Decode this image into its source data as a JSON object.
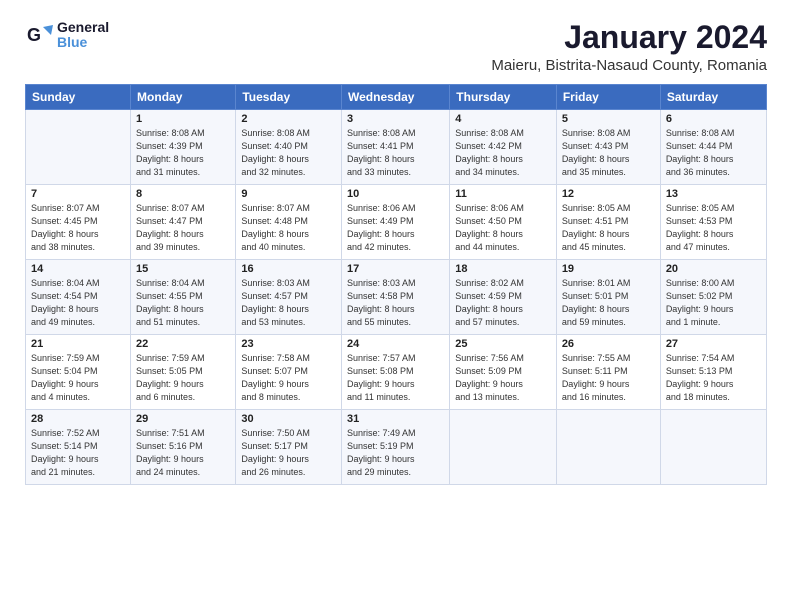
{
  "logo": {
    "line1": "General",
    "line2": "Blue"
  },
  "title": "January 2024",
  "subtitle": "Maieru, Bistrita-Nasaud County, Romania",
  "weekdays": [
    "Sunday",
    "Monday",
    "Tuesday",
    "Wednesday",
    "Thursday",
    "Friday",
    "Saturday"
  ],
  "weeks": [
    [
      {
        "day": "",
        "info": ""
      },
      {
        "day": "1",
        "info": "Sunrise: 8:08 AM\nSunset: 4:39 PM\nDaylight: 8 hours\nand 31 minutes."
      },
      {
        "day": "2",
        "info": "Sunrise: 8:08 AM\nSunset: 4:40 PM\nDaylight: 8 hours\nand 32 minutes."
      },
      {
        "day": "3",
        "info": "Sunrise: 8:08 AM\nSunset: 4:41 PM\nDaylight: 8 hours\nand 33 minutes."
      },
      {
        "day": "4",
        "info": "Sunrise: 8:08 AM\nSunset: 4:42 PM\nDaylight: 8 hours\nand 34 minutes."
      },
      {
        "day": "5",
        "info": "Sunrise: 8:08 AM\nSunset: 4:43 PM\nDaylight: 8 hours\nand 35 minutes."
      },
      {
        "day": "6",
        "info": "Sunrise: 8:08 AM\nSunset: 4:44 PM\nDaylight: 8 hours\nand 36 minutes."
      }
    ],
    [
      {
        "day": "7",
        "info": "Sunrise: 8:07 AM\nSunset: 4:45 PM\nDaylight: 8 hours\nand 38 minutes."
      },
      {
        "day": "8",
        "info": "Sunrise: 8:07 AM\nSunset: 4:47 PM\nDaylight: 8 hours\nand 39 minutes."
      },
      {
        "day": "9",
        "info": "Sunrise: 8:07 AM\nSunset: 4:48 PM\nDaylight: 8 hours\nand 40 minutes."
      },
      {
        "day": "10",
        "info": "Sunrise: 8:06 AM\nSunset: 4:49 PM\nDaylight: 8 hours\nand 42 minutes."
      },
      {
        "day": "11",
        "info": "Sunrise: 8:06 AM\nSunset: 4:50 PM\nDaylight: 8 hours\nand 44 minutes."
      },
      {
        "day": "12",
        "info": "Sunrise: 8:05 AM\nSunset: 4:51 PM\nDaylight: 8 hours\nand 45 minutes."
      },
      {
        "day": "13",
        "info": "Sunrise: 8:05 AM\nSunset: 4:53 PM\nDaylight: 8 hours\nand 47 minutes."
      }
    ],
    [
      {
        "day": "14",
        "info": "Sunrise: 8:04 AM\nSunset: 4:54 PM\nDaylight: 8 hours\nand 49 minutes."
      },
      {
        "day": "15",
        "info": "Sunrise: 8:04 AM\nSunset: 4:55 PM\nDaylight: 8 hours\nand 51 minutes."
      },
      {
        "day": "16",
        "info": "Sunrise: 8:03 AM\nSunset: 4:57 PM\nDaylight: 8 hours\nand 53 minutes."
      },
      {
        "day": "17",
        "info": "Sunrise: 8:03 AM\nSunset: 4:58 PM\nDaylight: 8 hours\nand 55 minutes."
      },
      {
        "day": "18",
        "info": "Sunrise: 8:02 AM\nSunset: 4:59 PM\nDaylight: 8 hours\nand 57 minutes."
      },
      {
        "day": "19",
        "info": "Sunrise: 8:01 AM\nSunset: 5:01 PM\nDaylight: 8 hours\nand 59 minutes."
      },
      {
        "day": "20",
        "info": "Sunrise: 8:00 AM\nSunset: 5:02 PM\nDaylight: 9 hours\nand 1 minute."
      }
    ],
    [
      {
        "day": "21",
        "info": "Sunrise: 7:59 AM\nSunset: 5:04 PM\nDaylight: 9 hours\nand 4 minutes."
      },
      {
        "day": "22",
        "info": "Sunrise: 7:59 AM\nSunset: 5:05 PM\nDaylight: 9 hours\nand 6 minutes."
      },
      {
        "day": "23",
        "info": "Sunrise: 7:58 AM\nSunset: 5:07 PM\nDaylight: 9 hours\nand 8 minutes."
      },
      {
        "day": "24",
        "info": "Sunrise: 7:57 AM\nSunset: 5:08 PM\nDaylight: 9 hours\nand 11 minutes."
      },
      {
        "day": "25",
        "info": "Sunrise: 7:56 AM\nSunset: 5:09 PM\nDaylight: 9 hours\nand 13 minutes."
      },
      {
        "day": "26",
        "info": "Sunrise: 7:55 AM\nSunset: 5:11 PM\nDaylight: 9 hours\nand 16 minutes."
      },
      {
        "day": "27",
        "info": "Sunrise: 7:54 AM\nSunset: 5:13 PM\nDaylight: 9 hours\nand 18 minutes."
      }
    ],
    [
      {
        "day": "28",
        "info": "Sunrise: 7:52 AM\nSunset: 5:14 PM\nDaylight: 9 hours\nand 21 minutes."
      },
      {
        "day": "29",
        "info": "Sunrise: 7:51 AM\nSunset: 5:16 PM\nDaylight: 9 hours\nand 24 minutes."
      },
      {
        "day": "30",
        "info": "Sunrise: 7:50 AM\nSunset: 5:17 PM\nDaylight: 9 hours\nand 26 minutes."
      },
      {
        "day": "31",
        "info": "Sunrise: 7:49 AM\nSunset: 5:19 PM\nDaylight: 9 hours\nand 29 minutes."
      },
      {
        "day": "",
        "info": ""
      },
      {
        "day": "",
        "info": ""
      },
      {
        "day": "",
        "info": ""
      }
    ]
  ]
}
